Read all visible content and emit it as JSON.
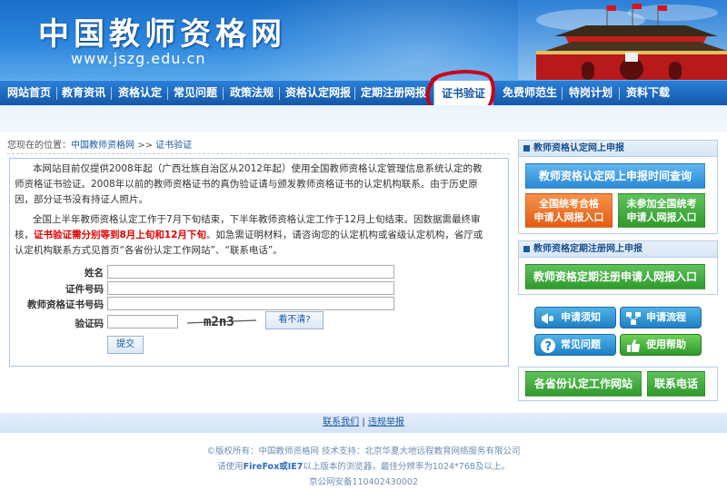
{
  "site": {
    "title": "中国教师资格网",
    "url": "www.jszg.edu.cn"
  },
  "nav": {
    "items": [
      "网站首页",
      "教育资讯",
      "资格认定",
      "常见问题",
      "政策法规",
      "资格认定网报",
      "定期注册网报",
      "证书验证",
      "免费师范生",
      "特岗计划",
      "资料下载"
    ],
    "active": "证书验证"
  },
  "breadcrumb": {
    "prefix": "您现在的位置：",
    "home": "中国教师资格网",
    "sep": ">>",
    "current": "证书验证"
  },
  "main": {
    "para1": "本网站目前仅提供2008年起（广西壮族自治区从2012年起）使用全国教师资格认定管理信息系统认定的教师资格证书验证。2008年以前的教师资格证书的真伪验证请与颁发教师资格证书的认定机构联系。由于历史原因，部分证书没有持证人照片。",
    "para2_a": "全国上半年教师资格认定工作于7月下旬结束，下半年教师资格认定工作于12月上旬结束。因数据需最终审核，",
    "para2_red": "证书验证需分别等到8月上旬和12月下旬",
    "para2_b": "。如急需证明材料，请咨询您的认定机构或省级认定机构，省厅或认定机构联系方式见首页“各省份认定工作网站”、“联系电话”。",
    "form": {
      "name_label": "姓名",
      "id_label": "证件号码",
      "cert_label": "教师资格证书号码",
      "captcha_label": "验证码",
      "name_value": "",
      "id_value": "",
      "cert_value": "",
      "captcha_value": "",
      "captcha_text": "m2n3",
      "unclear_button": "看不清?",
      "submit_button": "提交"
    }
  },
  "sidebar": {
    "section1_title": "教师资格认定网上申报",
    "query_time": "教师资格认定网上申报时间查询",
    "unified_line1": "全国统考合格",
    "unified_line2": "申请人网报入口",
    "non_unified_line1": "未参加全国统考",
    "non_unified_line2": "申请人网报入口",
    "section2_title": "教师资格定期注册网上申报",
    "registration_entry": "教师资格定期注册申请人网报入口",
    "icon_buttons": [
      "申请须知",
      "申请流程",
      "常见问题",
      "使用帮助"
    ],
    "provinces_button": "各省份认定工作网站",
    "contact_button": "联系电话"
  },
  "footer": {
    "contact": "联系我们",
    "sep": "|",
    "report": "违规举报",
    "copyright": "©版权所有：中国教师资格网  技术支持：北京华夏大地远程教育网络服务有限公司",
    "browser_a": "请使用",
    "browser_b": "FireFox或IE7",
    "browser_c": "以上版本的浏览器，最佳分辨率为1024*768及以上。",
    "icp": "京公网安备110402430002"
  },
  "colors": {
    "header_blue": "#1a6fc9",
    "nav_blue": "#1557a8",
    "annotation_red": "#c8001a",
    "red_text": "#e00000",
    "side_green": "#2f9a2c",
    "side_orange": "#e45d14"
  }
}
